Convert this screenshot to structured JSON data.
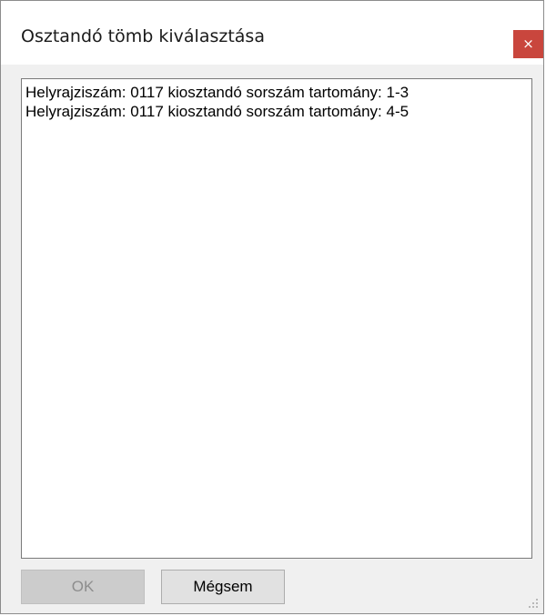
{
  "window": {
    "title": "Osztandó tömb kiválasztása",
    "close_glyph": "×"
  },
  "list": {
    "items": [
      "Helyrajziszám: 0117 kiosztandó sorszám tartomány: 1-3",
      "Helyrajziszám: 0117 kiosztandó sorszám tartomány: 4-5"
    ]
  },
  "buttons": {
    "ok_label": "OK",
    "ok_enabled": false,
    "cancel_label": "Mégsem"
  },
  "colors": {
    "close_button": "#c9463d",
    "dialog_background": "#f0f0f0",
    "disabled_button": "#cccccc"
  },
  "icons": {
    "close": "close-icon",
    "resize_grip": "resize-grip-icon"
  }
}
